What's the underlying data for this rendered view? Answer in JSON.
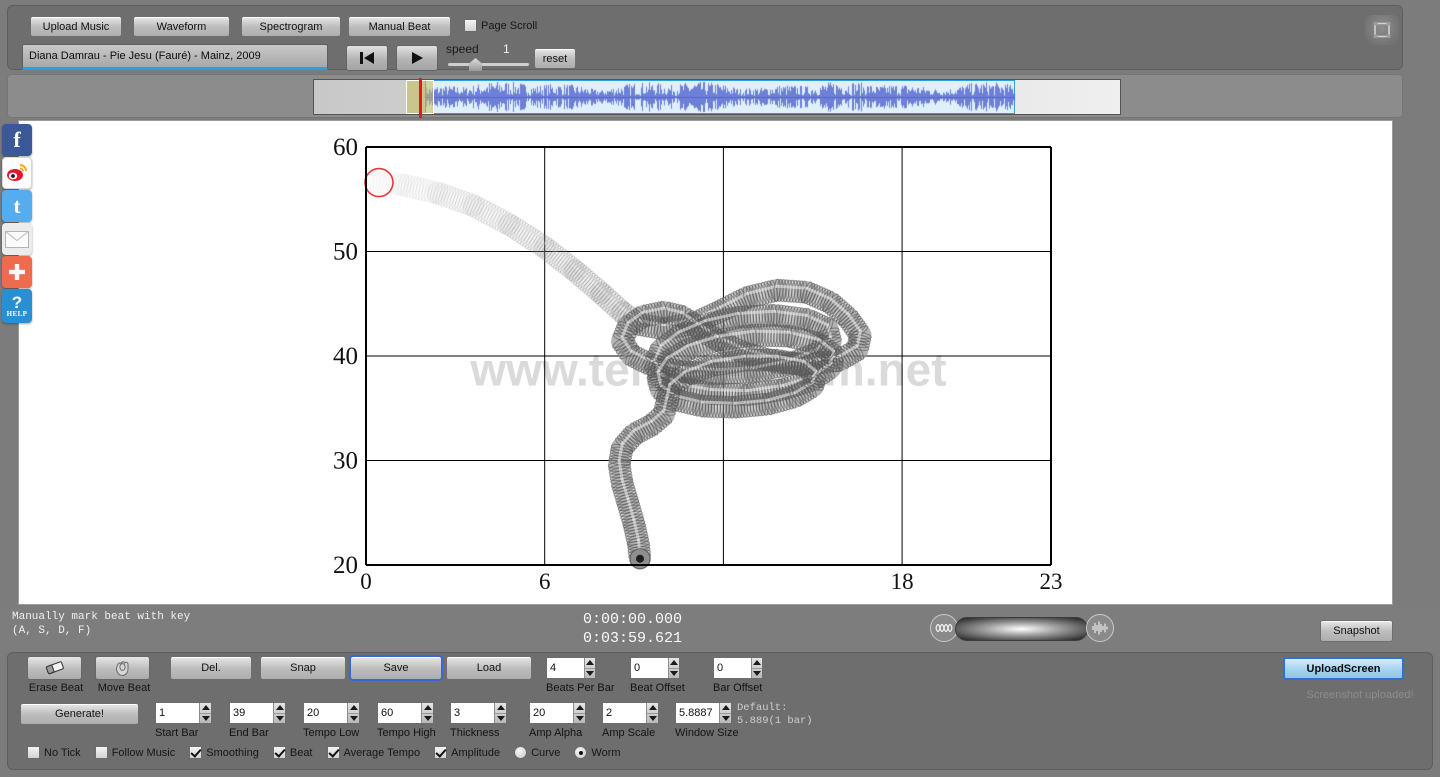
{
  "toolbar": {
    "buttons": [
      {
        "id": "upload-music",
        "label": "Upload Music"
      },
      {
        "id": "waveform",
        "label": "Waveform"
      },
      {
        "id": "spectrogram",
        "label": "Spectrogram"
      },
      {
        "id": "manual-beat",
        "label": "Manual Beat"
      }
    ],
    "page_scroll_label": "Page Scroll",
    "page_scroll_checked": false,
    "song_title": "Diana Damrau - Pie Jesu (Fauré) - Mainz, 2009",
    "speed_label": "speed",
    "speed_value": "1",
    "reset_label": "reset",
    "corner_icon": "fullscreen-icon"
  },
  "status": {
    "hint_line1": "Manually mark beat with key",
    "hint_line2": "(A, S, D, F)",
    "time_current": "0:00:00.000",
    "time_total": "0:03:59.621",
    "snapshot_label": "Snapshot"
  },
  "upload": {
    "button_label": "UploadScreen",
    "message": "Screenshot uploaded!"
  },
  "controls": {
    "row1_buttons": [
      {
        "id": "erase-beat",
        "caption": "Erase Beat",
        "icon": "eraser-icon"
      },
      {
        "id": "move-beat",
        "caption": "Move Beat",
        "icon": "hand-move-icon"
      }
    ],
    "row1_text_buttons": [
      {
        "id": "del",
        "label": "Del."
      },
      {
        "id": "snap",
        "label": "Snap"
      },
      {
        "id": "save",
        "label": "Save",
        "focused": true
      },
      {
        "id": "load",
        "label": "Load"
      }
    ],
    "generate_label": "Generate!",
    "spinners_row1": [
      {
        "id": "beats-per-bar",
        "value": "4",
        "caption": "Beats Per Bar"
      },
      {
        "id": "beat-offset",
        "value": "0",
        "caption": "Beat Offset"
      },
      {
        "id": "bar-offset",
        "value": "0",
        "caption": "Bar Offset"
      }
    ],
    "spinners_row2": [
      {
        "id": "start-bar",
        "value": "1",
        "caption": "Start Bar"
      },
      {
        "id": "end-bar",
        "value": "39",
        "caption": "End Bar"
      },
      {
        "id": "tempo-low",
        "value": "20",
        "caption": "Tempo Low"
      },
      {
        "id": "tempo-high",
        "value": "60",
        "caption": "Tempo High"
      },
      {
        "id": "thickness",
        "value": "3",
        "caption": "Thickness"
      },
      {
        "id": "amp-alpha",
        "value": "20",
        "caption": "Amp Alpha"
      },
      {
        "id": "amp-scale",
        "value": "2",
        "caption": "Amp Scale"
      },
      {
        "id": "window-size",
        "value": "5.8887",
        "caption": "Window Size"
      }
    ],
    "default_note_line1": "Default:",
    "default_note_line2": "5.889(1 bar)",
    "checkboxes": [
      {
        "id": "no-tick",
        "label": "No Tick",
        "checked": false
      },
      {
        "id": "follow-music",
        "label": "Follow Music",
        "checked": false
      },
      {
        "id": "smoothing",
        "label": "Smoothing",
        "checked": true
      },
      {
        "id": "beat",
        "label": "Beat",
        "checked": true
      },
      {
        "id": "average-tempo",
        "label": "Average Tempo",
        "checked": true
      },
      {
        "id": "amplitude",
        "label": "Amplitude",
        "checked": true
      }
    ],
    "radios": [
      {
        "id": "curve",
        "label": "Curve",
        "selected": false
      },
      {
        "id": "worm",
        "label": "Worm",
        "selected": true
      }
    ]
  },
  "sidebar": {
    "items": [
      {
        "id": "facebook",
        "icon": "facebook-icon",
        "glyph": "f",
        "color": "#3b5998"
      },
      {
        "id": "weibo",
        "icon": "weibo-icon",
        "glyph": "",
        "color": "#e6162d"
      },
      {
        "id": "twitter",
        "icon": "twitter-icon",
        "glyph": "t",
        "color": "#55acee"
      },
      {
        "id": "email",
        "icon": "email-icon",
        "glyph": "",
        "color": "#e9e9e9"
      },
      {
        "id": "more-share",
        "icon": "plus-share-icon",
        "glyph": "+",
        "color": "#ef6b4e"
      },
      {
        "id": "help",
        "icon": "help-icon",
        "glyph": "?",
        "color": "#2a8fd0",
        "caption": "HELP"
      }
    ]
  },
  "chart_data": {
    "type": "line",
    "title": "",
    "xlabel": "",
    "ylabel": "",
    "xlim": [
      0,
      23
    ],
    "ylim": [
      20,
      60
    ],
    "xticks": [
      "0",
      "6",
      "18",
      "23"
    ],
    "xtick_values": [
      0,
      6,
      18,
      23
    ],
    "yticks": [
      "20",
      "30",
      "40",
      "50",
      "60"
    ],
    "ytick_values": [
      20,
      30,
      40,
      50,
      60
    ],
    "gridlines_x": [
      6,
      12,
      18
    ],
    "gridlines_y": [
      30,
      40,
      50
    ],
    "grid": true,
    "legend": "none",
    "series_name": "tempo-worm",
    "marker_start": {
      "x": 0.1,
      "y": 56.6,
      "label": "start-marker",
      "color": "#e8383c"
    },
    "annotations": [
      {
        "id": "watermark",
        "text": "www.tempo-worm.net"
      }
    ],
    "path_points": [
      [
        0.15,
        56.7
      ],
      [
        1.2,
        56.4
      ],
      [
        2.4,
        55.6
      ],
      [
        3.6,
        54.4
      ],
      [
        4.8,
        52.6
      ],
      [
        6.0,
        50.4
      ],
      [
        7.0,
        48.2
      ],
      [
        7.9,
        46.0
      ],
      [
        8.6,
        44.2
      ],
      [
        9.2,
        43.0
      ],
      [
        10.0,
        42.6
      ],
      [
        11.0,
        43.1
      ],
      [
        11.9,
        44.3
      ],
      [
        12.8,
        45.6
      ],
      [
        13.8,
        46.3
      ],
      [
        14.8,
        46.1
      ],
      [
        15.6,
        45.1
      ],
      [
        16.2,
        43.6
      ],
      [
        16.6,
        42.0
      ],
      [
        16.5,
        40.6
      ],
      [
        15.9,
        39.6
      ],
      [
        14.9,
        39.2
      ],
      [
        13.8,
        39.4
      ],
      [
        12.7,
        40.3
      ],
      [
        11.8,
        41.5
      ],
      [
        11.1,
        42.8
      ],
      [
        10.6,
        43.8
      ],
      [
        10.0,
        44.2
      ],
      [
        9.3,
        43.8
      ],
      [
        8.8,
        42.8
      ],
      [
        8.6,
        41.4
      ],
      [
        8.9,
        40.1
      ],
      [
        9.6,
        39.1
      ],
      [
        10.6,
        38.5
      ],
      [
        11.8,
        38.3
      ],
      [
        13.0,
        38.5
      ],
      [
        14.2,
        39.2
      ],
      [
        15.1,
        40.2
      ],
      [
        15.6,
        41.4
      ],
      [
        15.5,
        42.6
      ],
      [
        14.8,
        43.5
      ],
      [
        13.7,
        43.9
      ],
      [
        12.5,
        43.7
      ],
      [
        11.4,
        43.0
      ],
      [
        10.5,
        41.9
      ],
      [
        9.9,
        40.6
      ],
      [
        9.7,
        39.2
      ],
      [
        9.9,
        37.9
      ],
      [
        10.6,
        36.9
      ],
      [
        11.6,
        36.4
      ],
      [
        12.8,
        36.3
      ],
      [
        14.0,
        36.8
      ],
      [
        15.0,
        37.7
      ],
      [
        15.6,
        38.9
      ],
      [
        15.7,
        40.1
      ],
      [
        15.2,
        41.2
      ],
      [
        14.2,
        41.9
      ],
      [
        13.0,
        42.0
      ],
      [
        11.8,
        41.5
      ],
      [
        10.8,
        40.6
      ],
      [
        10.1,
        39.4
      ],
      [
        9.8,
        38.1
      ],
      [
        9.9,
        36.8
      ],
      [
        10.4,
        35.8
      ],
      [
        11.3,
        35.2
      ],
      [
        12.4,
        35.1
      ],
      [
        13.5,
        35.4
      ],
      [
        14.4,
        36.1
      ],
      [
        15.0,
        37.1
      ],
      [
        15.1,
        38.2
      ],
      [
        14.7,
        39.1
      ],
      [
        13.8,
        39.6
      ],
      [
        12.7,
        39.6
      ],
      [
        11.6,
        39.1
      ],
      [
        10.7,
        38.1
      ],
      [
        10.2,
        36.9
      ],
      [
        10.1,
        35.6
      ],
      [
        10.0,
        34.4
      ],
      [
        9.6,
        33.4
      ],
      [
        9.0,
        32.5
      ],
      [
        8.6,
        31.2
      ],
      [
        8.5,
        29.6
      ],
      [
        8.6,
        27.8
      ],
      [
        8.8,
        25.9
      ],
      [
        9.0,
        23.9
      ],
      [
        9.15,
        22.0
      ],
      [
        9.2,
        20.6
      ]
    ]
  }
}
